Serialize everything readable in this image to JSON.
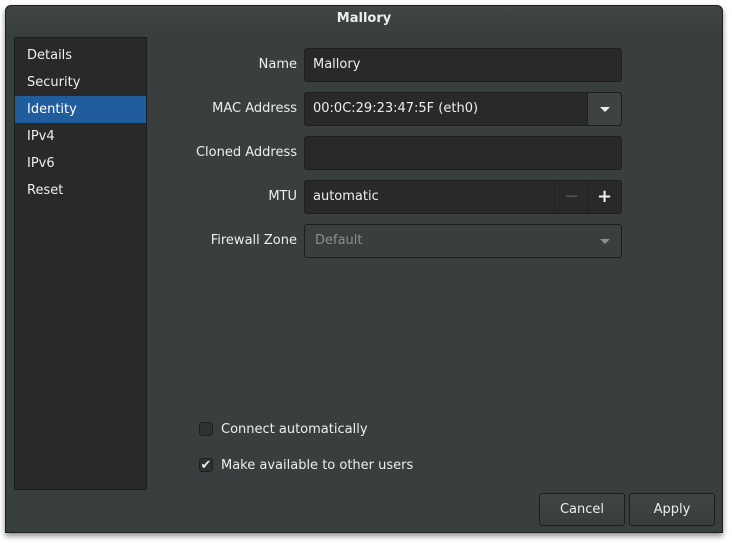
{
  "window": {
    "title": "Mallory"
  },
  "sidebar": {
    "items": [
      {
        "label": "Details",
        "selected": false
      },
      {
        "label": "Security",
        "selected": false
      },
      {
        "label": "Identity",
        "selected": true
      },
      {
        "label": "IPv4",
        "selected": false
      },
      {
        "label": "IPv6",
        "selected": false
      },
      {
        "label": "Reset",
        "selected": false
      }
    ]
  },
  "form": {
    "name": {
      "label": "Name",
      "value": "Mallory"
    },
    "mac": {
      "label": "MAC Address",
      "value": "00:0C:29:23:47:5F (eth0)",
      "icon": "chevron-down-icon"
    },
    "cloned": {
      "label": "Cloned Address",
      "value": ""
    },
    "mtu": {
      "label": "MTU",
      "value": "automatic",
      "minus": "−",
      "plus": "+"
    },
    "firewall": {
      "label": "Firewall Zone",
      "value": "Default",
      "icon": "chevron-down-icon"
    }
  },
  "options": {
    "connect_auto": {
      "label": "Connect automatically",
      "checked": false,
      "mark": ""
    },
    "available_all": {
      "label": "Make available to other users",
      "checked": true,
      "mark": "✔"
    }
  },
  "buttons": {
    "cancel": "Cancel",
    "apply": "Apply"
  }
}
